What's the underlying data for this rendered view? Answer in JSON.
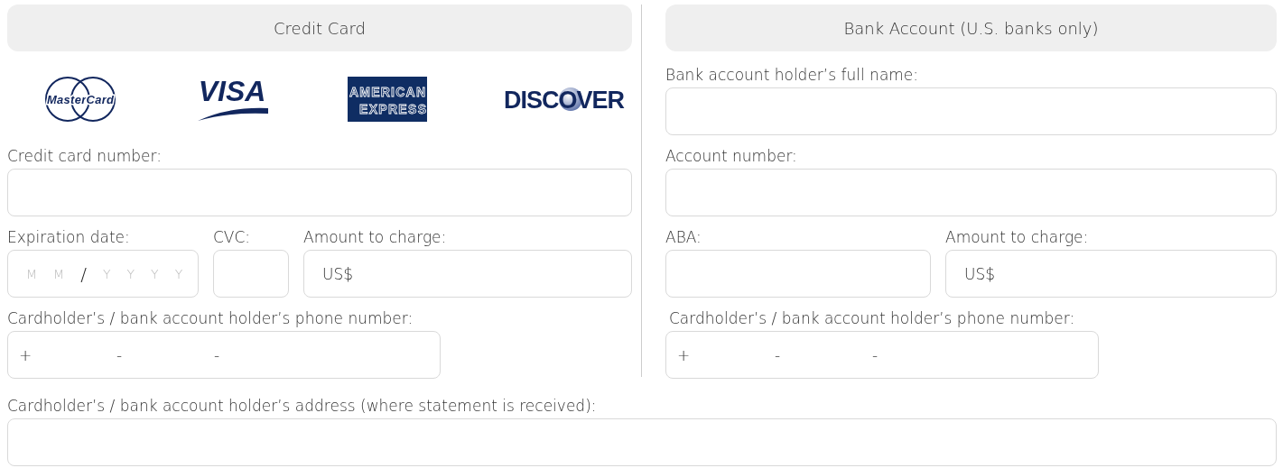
{
  "credit_card": {
    "header": "Credit Card",
    "logos": [
      {
        "kind": "mastercard",
        "lines": [
          "MasterCard"
        ]
      },
      {
        "kind": "visa",
        "lines": [
          "VISA"
        ]
      },
      {
        "kind": "amex",
        "lines": [
          "AMERICAN",
          "EXPRESS"
        ]
      },
      {
        "kind": "discover",
        "lines": [
          "DISCOVER"
        ]
      }
    ],
    "card_number": {
      "label": "Credit card number:"
    },
    "expiration": {
      "label": "Expiration date:",
      "month": [
        "M",
        "M"
      ],
      "separator": "/",
      "year": [
        "Y",
        "Y",
        "Y",
        "Y"
      ]
    },
    "cvc": {
      "label": "CVC:"
    },
    "amount": {
      "label": "Amount to charge:",
      "prefix": "US$"
    },
    "phone": {
      "label": "Cardholder’s / bank account holder’s phone number:",
      "parts": [
        "+",
        "-",
        "-"
      ]
    }
  },
  "bank_account": {
    "header": "Bank Account (U.S. banks only)",
    "holder_name": {
      "label": "Bank account holder’s full name:"
    },
    "account_number": {
      "label": "Account number:"
    },
    "aba": {
      "label": "ABA:"
    },
    "amount": {
      "label": "Amount to charge:",
      "prefix": "US$"
    },
    "phone": {
      "label": "Cardholder’s / bank account holder’s phone number:",
      "parts": [
        "+",
        "-",
        "-"
      ]
    }
  },
  "address": {
    "label": "Cardholder’s / bank account holder’s address (where statement is received):"
  }
}
